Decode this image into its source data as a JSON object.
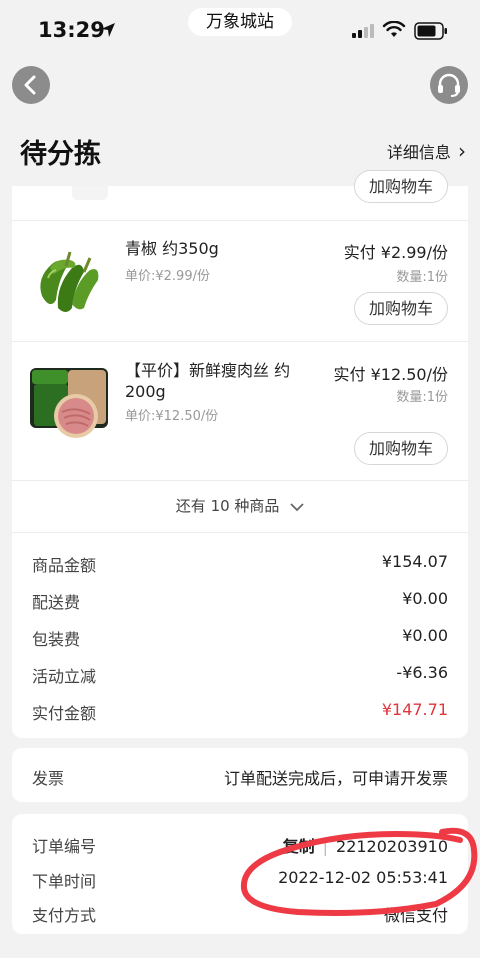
{
  "status_bar": {
    "time": "13:29",
    "site": "万象城站"
  },
  "header": {
    "title": "待分拣",
    "detail_link": "详细信息",
    "chevron": "›"
  },
  "goods": {
    "add_to_cart_label": "加购物车",
    "items": [
      {
        "name": "青椒 约350g",
        "unit_price": "单价:¥2.99/份",
        "paid": "实付 ¥2.99/份",
        "qty": "数量:1份",
        "image": "green-pepper"
      },
      {
        "name": "【平价】新鲜瘦肉丝 约200g",
        "unit_price": "单价:¥12.50/份",
        "paid": "实付 ¥12.50/份",
        "qty": "数量:1份",
        "image": "shredded-pork-package"
      }
    ],
    "more": "还有 10 种商品"
  },
  "summary": [
    {
      "label": "商品金额",
      "value": "¥154.07"
    },
    {
      "label": "配送费",
      "value": "¥0.00"
    },
    {
      "label": "包装费",
      "value": "¥0.00"
    },
    {
      "label": "活动立减",
      "value": "-¥6.36"
    },
    {
      "label": "实付金额",
      "value": "¥147.71",
      "color": "#e0353b"
    }
  ],
  "invoice": {
    "label": "发票",
    "value": "订单配送完成后，可申请开发票"
  },
  "order": {
    "id_label": "订单编号",
    "copy_label": "复制",
    "id_value": "22120203910",
    "time_label": "下单时间",
    "time_value": "2022-12-02 05:53:41",
    "pay_label": "支付方式",
    "pay_value": "微信支付"
  },
  "colors": {
    "accent_red": "#e0353b",
    "background": "#f2f2f2",
    "annotation_red": "#ee3a44"
  }
}
